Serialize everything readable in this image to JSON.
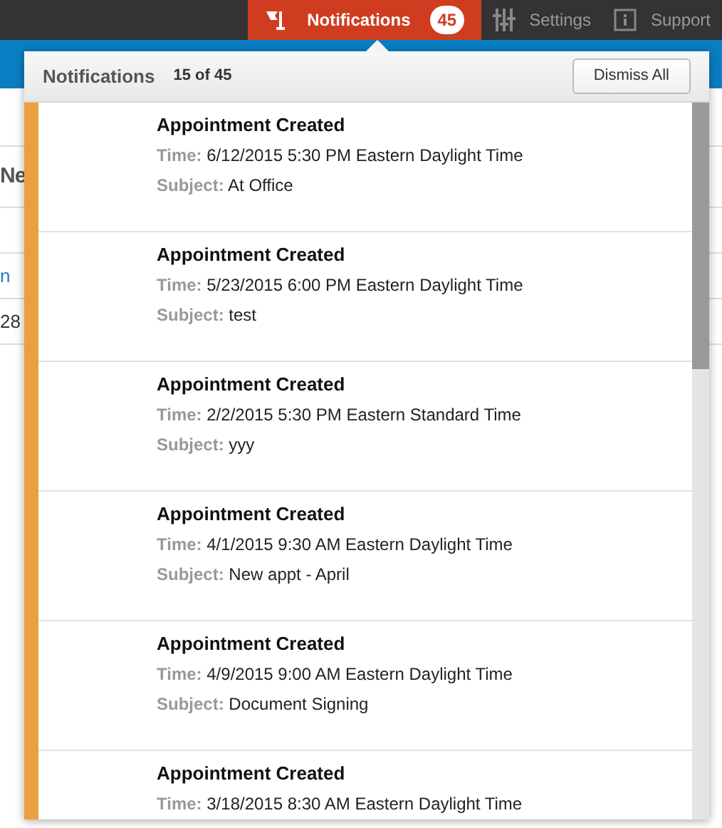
{
  "top_bar": {
    "items": [
      {
        "kind": "notifications",
        "label": "Notifications",
        "badge": "45",
        "selected": true
      },
      {
        "kind": "settings",
        "label": "Settings",
        "selected": false
      },
      {
        "kind": "support",
        "label": "Support",
        "selected": false
      }
    ]
  },
  "background": {
    "heading": "Ne",
    "link": "n",
    "cell": "28"
  },
  "popup": {
    "title": "Notifications",
    "count": "15 of 45",
    "dismiss_button": "Dismiss All",
    "items": [
      {
        "title": "Appointment Created",
        "time_label": "Time:",
        "time": "6/12/2015 5:30 PM Eastern Daylight Time",
        "subject_label": "Subject:",
        "subject": "At Office"
      },
      {
        "title": "Appointment Created",
        "time_label": "Time:",
        "time": "5/23/2015 6:00 PM Eastern Daylight Time",
        "subject_label": "Subject:",
        "subject": "test"
      },
      {
        "title": "Appointment Created",
        "time_label": "Time:",
        "time": "2/2/2015 5:30 PM Eastern Standard Time",
        "subject_label": "Subject:",
        "subject": "yyy"
      },
      {
        "title": "Appointment Created",
        "time_label": "Time:",
        "time": "4/1/2015 9:30 AM Eastern Daylight Time",
        "subject_label": "Subject:",
        "subject": "New appt - April"
      },
      {
        "title": "Appointment Created",
        "time_label": "Time:",
        "time": "4/9/2015 9:00 AM Eastern Daylight Time",
        "subject_label": "Subject:",
        "subject": "Document Signing"
      },
      {
        "title": "Appointment Created",
        "time_label": "Time:",
        "time": "3/18/2015 8:30 AM Eastern Daylight Time"
      }
    ]
  }
}
